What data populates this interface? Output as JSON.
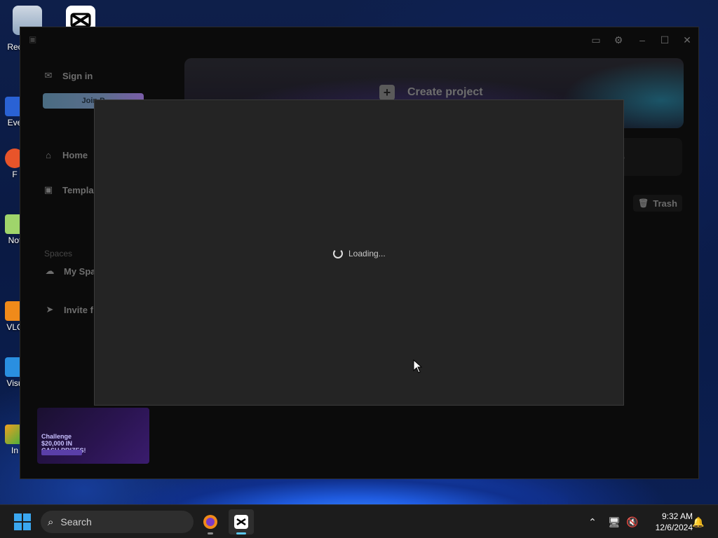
{
  "desktop": {
    "icons": [
      {
        "label": "Rec"
      },
      {
        "label": "Eve"
      },
      {
        "label": "F"
      },
      {
        "label": "Not"
      },
      {
        "label": "VLC"
      },
      {
        "label": "Visu"
      },
      {
        "label": "In"
      }
    ]
  },
  "app": {
    "sidebar": {
      "sign_in": "Sign in",
      "join": "Join P",
      "home": "Home",
      "templates": "Templa",
      "spaces_label": "Spaces",
      "my_space": "My Spa",
      "invite": "Invite f"
    },
    "promo": {
      "challenge": "Challenge",
      "prize": "$20,000 IN",
      "prize2": "CASH PRIZES!"
    },
    "main": {
      "create_project": "Create project",
      "trash": "Trash"
    },
    "dialog": {
      "loading_text": "Loading..."
    }
  },
  "taskbar": {
    "search_placeholder": "Search",
    "time": "9:32 AM",
    "date": "12/6/2024"
  },
  "colors": {
    "accent": "#3aa7f0",
    "dialog_bg": "#242424",
    "window_bg": "#0b0b0b"
  }
}
